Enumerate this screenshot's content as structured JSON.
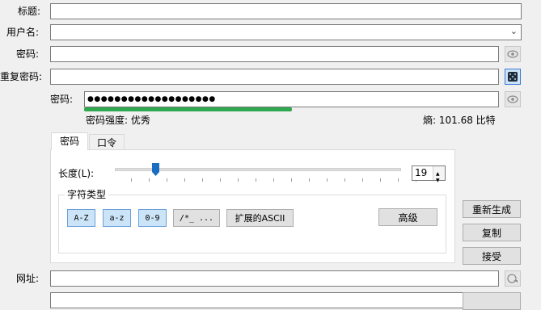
{
  "form": {
    "title_label": "标题:",
    "title_value": "",
    "username_label": "用户名:",
    "username_value": "",
    "password_label": "密码:",
    "password_value": "",
    "repeat_label": "重复密码:",
    "repeat_value": "",
    "gen_password_label": "密码:",
    "gen_password_value": "●●●●●●●●●●●●●●●●●●●",
    "strength_label": "密码强度: 优秀",
    "strength_fraction": 0.5,
    "entropy_label": "熵: 101.68 比特",
    "url_label": "网址:",
    "url_value": ""
  },
  "generator": {
    "tabs": [
      "密码",
      "口令"
    ],
    "active_tab": 0,
    "length_label": "长度(L):",
    "length_value": "19",
    "slider_fraction": 0.14,
    "charset_group_label": "字符类型",
    "charset_buttons": [
      {
        "label": "A-Z",
        "active": true
      },
      {
        "label": "a-z",
        "active": true
      },
      {
        "label": "0-9",
        "active": true
      },
      {
        "label": "/*_ ...",
        "active": false
      },
      {
        "label": "扩展的ASCII",
        "active": false
      }
    ],
    "advanced_label": "高级"
  },
  "actions": {
    "regenerate_label": "重新生成",
    "copy_label": "复制",
    "accept_label": "接受"
  },
  "colors": {
    "strength_bar": "#2fa84f",
    "slider_thumb": "#1b6dc1",
    "toggle_active": "#cce4f7"
  }
}
